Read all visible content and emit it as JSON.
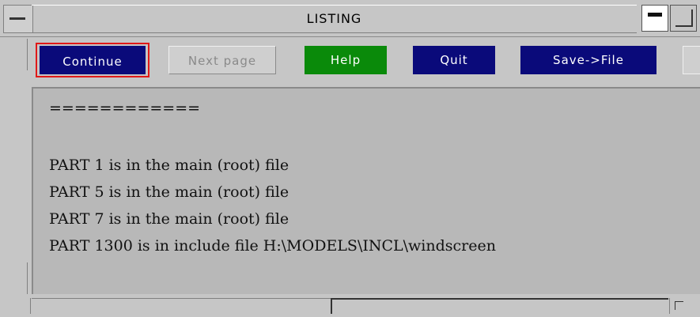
{
  "window": {
    "title": "LISTING"
  },
  "toolbar": {
    "continue_label": "Continue",
    "next_page_label": "Next page",
    "help_label": "Help",
    "quit_label": "Quit",
    "save_label": "Save->File"
  },
  "listing": {
    "lines": [
      "============",
      "",
      "PART 1 is in the main (root) file",
      "PART 5 is in the main (root) file",
      "PART 7 is in the main (root) file",
      "PART 1300 is in include file H:\\MODELS\\INCL\\windscreen"
    ]
  },
  "colors": {
    "button_blue": "#0a0a7a",
    "button_green": "#0a8a0a",
    "focus_ring": "#e01818",
    "listing_bg": "#b8b8b8"
  }
}
